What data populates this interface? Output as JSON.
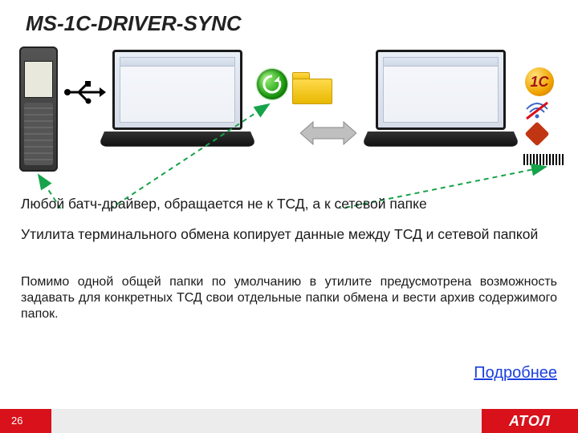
{
  "title": "MS-1C-DRIVER-SYNC",
  "paragraphs": {
    "p1": "Любой батч-драйвер, обращается не к ТСД, а к сетевой папке",
    "p2": "Утилита терминального обмена копирует данные между ТСД и сетевой папкой",
    "p3": "Помимо одной общей папки по умолчанию в утилите предусмотрена возможность задавать для конкретных ТСД свои отдельные папки обмена и вести архив содержимого папок."
  },
  "link": {
    "label": "Подробнее"
  },
  "footer": {
    "page": "26",
    "brand": "АТОЛ"
  },
  "logos": {
    "oneC": "1С"
  },
  "icons": {
    "usb": "usb-icon",
    "sync": "sync-icon",
    "folder": "folder-icon",
    "bidir": "bidirectional-arrow-icon",
    "wifiOff": "wifi-off-icon"
  }
}
